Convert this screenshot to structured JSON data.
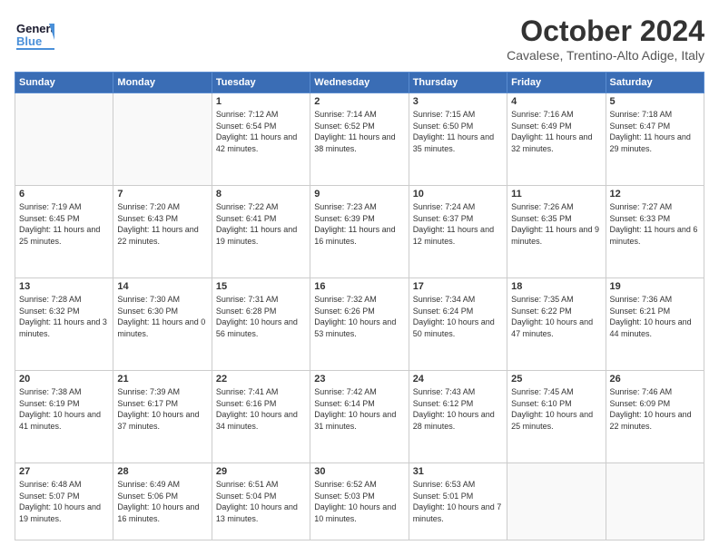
{
  "header": {
    "logo_general": "General",
    "logo_blue": "Blue",
    "month": "October 2024",
    "location": "Cavalese, Trentino-Alto Adige, Italy"
  },
  "weekdays": [
    "Sunday",
    "Monday",
    "Tuesday",
    "Wednesday",
    "Thursday",
    "Friday",
    "Saturday"
  ],
  "weeks": [
    [
      {
        "day": "",
        "content": ""
      },
      {
        "day": "",
        "content": ""
      },
      {
        "day": "1",
        "content": "Sunrise: 7:12 AM\nSunset: 6:54 PM\nDaylight: 11 hours and 42 minutes."
      },
      {
        "day": "2",
        "content": "Sunrise: 7:14 AM\nSunset: 6:52 PM\nDaylight: 11 hours and 38 minutes."
      },
      {
        "day": "3",
        "content": "Sunrise: 7:15 AM\nSunset: 6:50 PM\nDaylight: 11 hours and 35 minutes."
      },
      {
        "day": "4",
        "content": "Sunrise: 7:16 AM\nSunset: 6:49 PM\nDaylight: 11 hours and 32 minutes."
      },
      {
        "day": "5",
        "content": "Sunrise: 7:18 AM\nSunset: 6:47 PM\nDaylight: 11 hours and 29 minutes."
      }
    ],
    [
      {
        "day": "6",
        "content": "Sunrise: 7:19 AM\nSunset: 6:45 PM\nDaylight: 11 hours and 25 minutes."
      },
      {
        "day": "7",
        "content": "Sunrise: 7:20 AM\nSunset: 6:43 PM\nDaylight: 11 hours and 22 minutes."
      },
      {
        "day": "8",
        "content": "Sunrise: 7:22 AM\nSunset: 6:41 PM\nDaylight: 11 hours and 19 minutes."
      },
      {
        "day": "9",
        "content": "Sunrise: 7:23 AM\nSunset: 6:39 PM\nDaylight: 11 hours and 16 minutes."
      },
      {
        "day": "10",
        "content": "Sunrise: 7:24 AM\nSunset: 6:37 PM\nDaylight: 11 hours and 12 minutes."
      },
      {
        "day": "11",
        "content": "Sunrise: 7:26 AM\nSunset: 6:35 PM\nDaylight: 11 hours and 9 minutes."
      },
      {
        "day": "12",
        "content": "Sunrise: 7:27 AM\nSunset: 6:33 PM\nDaylight: 11 hours and 6 minutes."
      }
    ],
    [
      {
        "day": "13",
        "content": "Sunrise: 7:28 AM\nSunset: 6:32 PM\nDaylight: 11 hours and 3 minutes."
      },
      {
        "day": "14",
        "content": "Sunrise: 7:30 AM\nSunset: 6:30 PM\nDaylight: 11 hours and 0 minutes."
      },
      {
        "day": "15",
        "content": "Sunrise: 7:31 AM\nSunset: 6:28 PM\nDaylight: 10 hours and 56 minutes."
      },
      {
        "day": "16",
        "content": "Sunrise: 7:32 AM\nSunset: 6:26 PM\nDaylight: 10 hours and 53 minutes."
      },
      {
        "day": "17",
        "content": "Sunrise: 7:34 AM\nSunset: 6:24 PM\nDaylight: 10 hours and 50 minutes."
      },
      {
        "day": "18",
        "content": "Sunrise: 7:35 AM\nSunset: 6:22 PM\nDaylight: 10 hours and 47 minutes."
      },
      {
        "day": "19",
        "content": "Sunrise: 7:36 AM\nSunset: 6:21 PM\nDaylight: 10 hours and 44 minutes."
      }
    ],
    [
      {
        "day": "20",
        "content": "Sunrise: 7:38 AM\nSunset: 6:19 PM\nDaylight: 10 hours and 41 minutes."
      },
      {
        "day": "21",
        "content": "Sunrise: 7:39 AM\nSunset: 6:17 PM\nDaylight: 10 hours and 37 minutes."
      },
      {
        "day": "22",
        "content": "Sunrise: 7:41 AM\nSunset: 6:16 PM\nDaylight: 10 hours and 34 minutes."
      },
      {
        "day": "23",
        "content": "Sunrise: 7:42 AM\nSunset: 6:14 PM\nDaylight: 10 hours and 31 minutes."
      },
      {
        "day": "24",
        "content": "Sunrise: 7:43 AM\nSunset: 6:12 PM\nDaylight: 10 hours and 28 minutes."
      },
      {
        "day": "25",
        "content": "Sunrise: 7:45 AM\nSunset: 6:10 PM\nDaylight: 10 hours and 25 minutes."
      },
      {
        "day": "26",
        "content": "Sunrise: 7:46 AM\nSunset: 6:09 PM\nDaylight: 10 hours and 22 minutes."
      }
    ],
    [
      {
        "day": "27",
        "content": "Sunrise: 6:48 AM\nSunset: 5:07 PM\nDaylight: 10 hours and 19 minutes."
      },
      {
        "day": "28",
        "content": "Sunrise: 6:49 AM\nSunset: 5:06 PM\nDaylight: 10 hours and 16 minutes."
      },
      {
        "day": "29",
        "content": "Sunrise: 6:51 AM\nSunset: 5:04 PM\nDaylight: 10 hours and 13 minutes."
      },
      {
        "day": "30",
        "content": "Sunrise: 6:52 AM\nSunset: 5:03 PM\nDaylight: 10 hours and 10 minutes."
      },
      {
        "day": "31",
        "content": "Sunrise: 6:53 AM\nSunset: 5:01 PM\nDaylight: 10 hours and 7 minutes."
      },
      {
        "day": "",
        "content": ""
      },
      {
        "day": "",
        "content": ""
      }
    ]
  ]
}
